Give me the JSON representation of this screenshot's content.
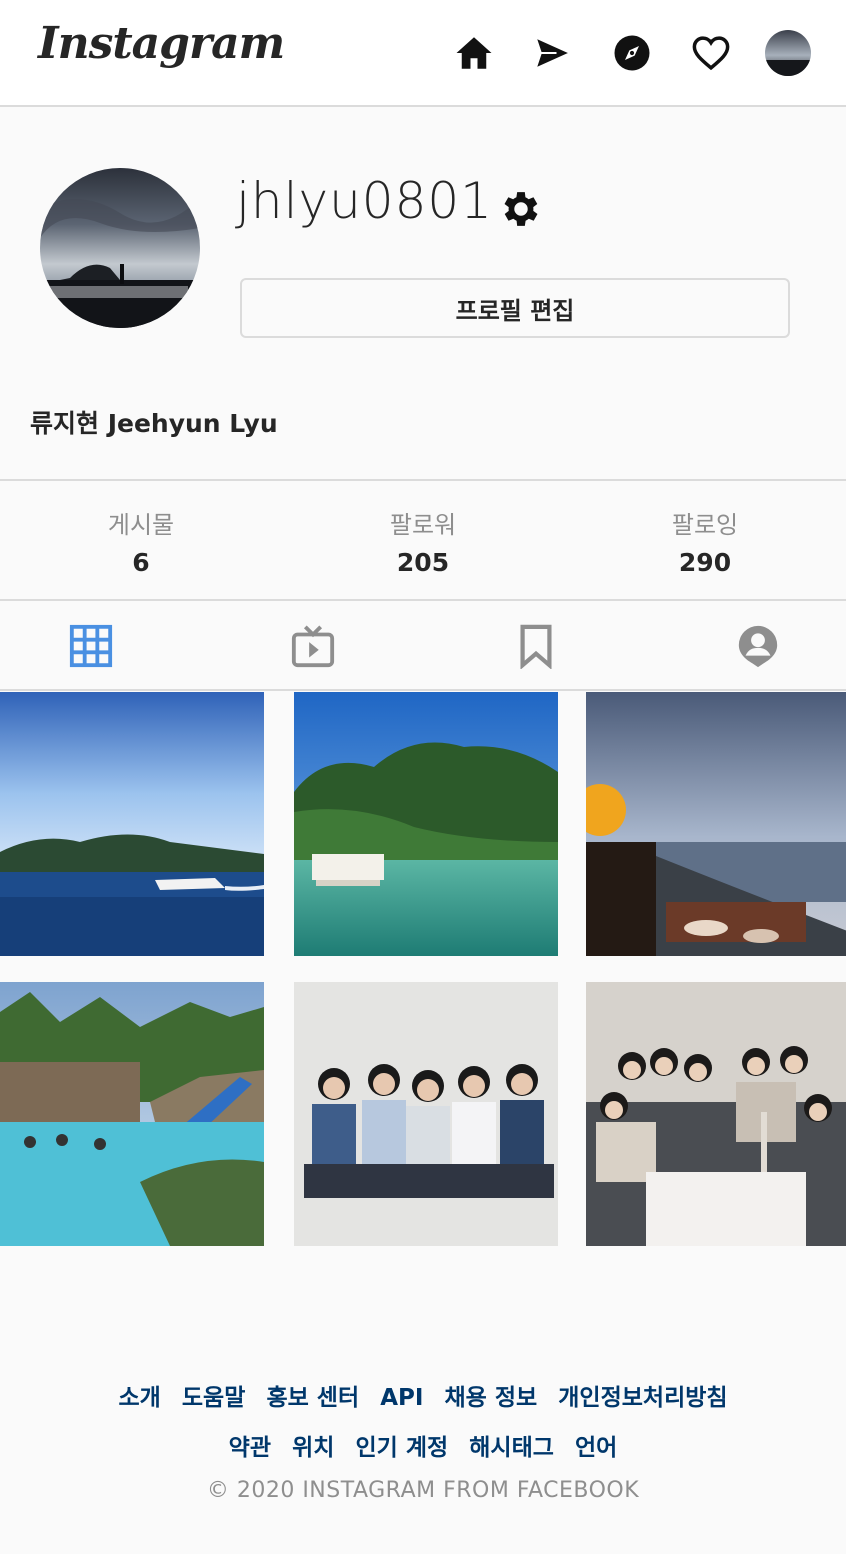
{
  "header": {
    "logo": "Instagram"
  },
  "profile": {
    "username": "jhlyu0801",
    "edit_button": "프로필 편집",
    "full_name": "류지현 Jeehyun Lyu"
  },
  "stats": [
    {
      "label": "게시물",
      "value": "6"
    },
    {
      "label": "팔로워",
      "value": "205"
    },
    {
      "label": "팔로잉",
      "value": "290"
    }
  ],
  "footer": {
    "row1": [
      "소개",
      "도움말",
      "홍보 센터",
      "API",
      "채용 정보",
      "개인정보처리방침"
    ],
    "row2": [
      "약관",
      "위치",
      "인기 계정",
      "해시태그",
      "언어"
    ],
    "copyright": "© 2020 INSTAGRAM FROM FACEBOOK"
  },
  "colors": {
    "active_tab": "#4a90e2",
    "footer_link": "#00376b",
    "muted": "#8e8e8e"
  }
}
